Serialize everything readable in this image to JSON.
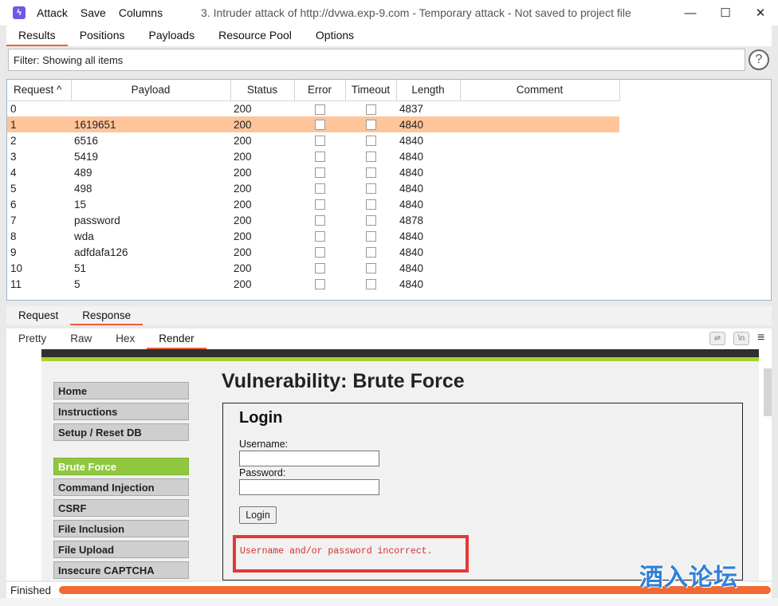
{
  "window": {
    "menu": [
      "Attack",
      "Save",
      "Columns"
    ],
    "title": "3. Intruder attack of http://dvwa.exp-9.com - Temporary attack - Not saved to project file",
    "controls": [
      "—",
      "☐",
      "✕"
    ]
  },
  "top_tabs": [
    "Results",
    "Positions",
    "Payloads",
    "Resource Pool",
    "Options"
  ],
  "filter": {
    "text": "Filter: Showing all items",
    "help": "?"
  },
  "table": {
    "headers": [
      "Request ^",
      "Payload",
      "Status",
      "Error",
      "Timeout",
      "Length",
      "Comment"
    ],
    "rows": [
      {
        "request": "0",
        "payload": "",
        "status": "200",
        "length": "4837",
        "selected": false
      },
      {
        "request": "1",
        "payload": "1619651",
        "status": "200",
        "length": "4840",
        "selected": true
      },
      {
        "request": "2",
        "payload": "6516",
        "status": "200",
        "length": "4840",
        "selected": false
      },
      {
        "request": "3",
        "payload": "5419",
        "status": "200",
        "length": "4840",
        "selected": false
      },
      {
        "request": "4",
        "payload": "489",
        "status": "200",
        "length": "4840",
        "selected": false
      },
      {
        "request": "5",
        "payload": "498",
        "status": "200",
        "length": "4840",
        "selected": false
      },
      {
        "request": "6",
        "payload": "15",
        "status": "200",
        "length": "4840",
        "selected": false
      },
      {
        "request": "7",
        "payload": "password",
        "status": "200",
        "length": "4878",
        "selected": false
      },
      {
        "request": "8",
        "payload": "wda",
        "status": "200",
        "length": "4840",
        "selected": false
      },
      {
        "request": "9",
        "payload": "adfdafa126",
        "status": "200",
        "length": "4840",
        "selected": false
      },
      {
        "request": "10",
        "payload": "51",
        "status": "200",
        "length": "4840",
        "selected": false
      },
      {
        "request": "11",
        "payload": "5",
        "status": "200",
        "length": "4840",
        "selected": false
      }
    ]
  },
  "rr_tabs": [
    "Request",
    "Response"
  ],
  "view_tabs": [
    "Pretty",
    "Raw",
    "Hex",
    "Render"
  ],
  "view_icons": [
    "wrap-icon",
    "newline-icon",
    "menu-icon"
  ],
  "dvwa": {
    "nav": [
      "Home",
      "Instructions",
      "Setup / Reset DB",
      "Brute Force",
      "Command Injection",
      "CSRF",
      "File Inclusion",
      "File Upload",
      "Insecure CAPTCHA"
    ],
    "active_nav": "Brute Force",
    "title": "Vulnerability: Brute Force",
    "login_title": "Login",
    "username_label": "Username:",
    "password_label": "Password:",
    "login_button": "Login",
    "error": "Username and/or password incorrect."
  },
  "status": {
    "text": "Finished",
    "progress": 1.0
  },
  "watermark": "酒入论坛",
  "colors": {
    "accent": "#e8613a",
    "selected_row": "#ffc59a",
    "dvwa_green": "#8fc83e",
    "error": "#e53935"
  }
}
